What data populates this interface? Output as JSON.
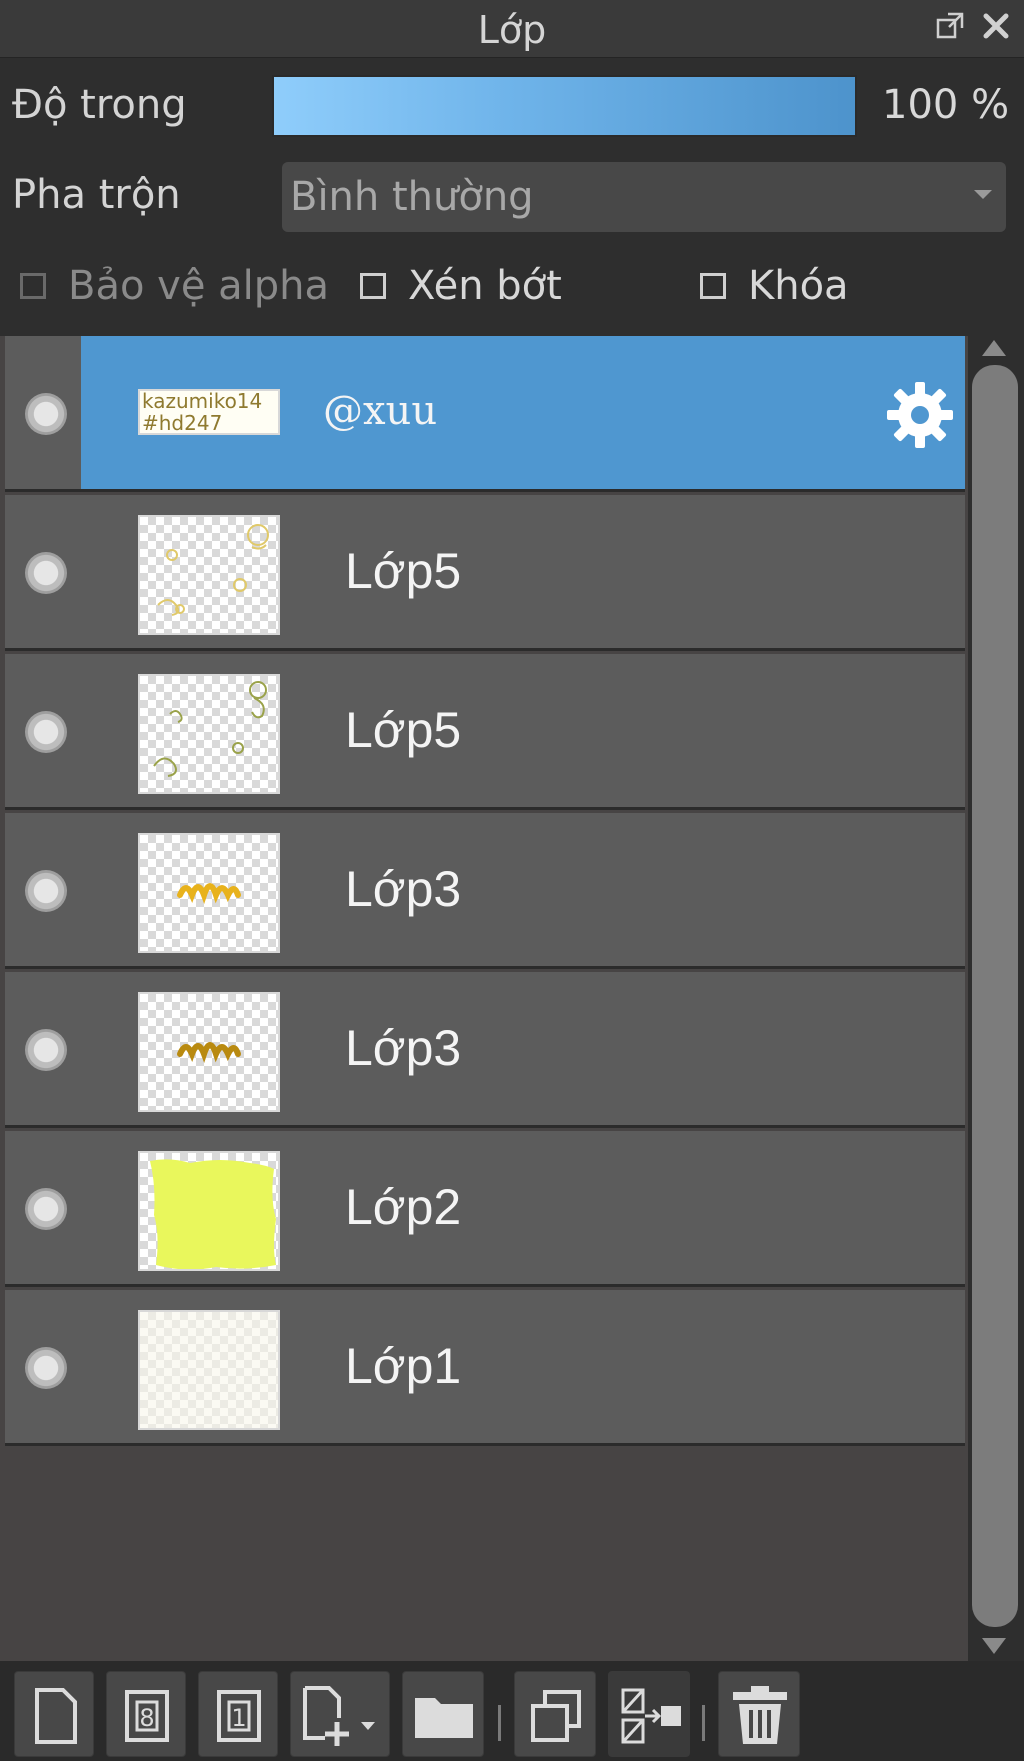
{
  "panel": {
    "title": "Lớp"
  },
  "opacity": {
    "label": "Độ trong",
    "value": "100 %",
    "level": 1.0
  },
  "blend": {
    "label": "Pha trộn",
    "value": "Bình thường"
  },
  "checks": {
    "alpha": {
      "label": "Bảo vệ alpha",
      "checked": false,
      "enabled": false
    },
    "clip": {
      "label": "Xén bớt",
      "checked": false,
      "enabled": true
    },
    "lock": {
      "label": "Khóa",
      "checked": false,
      "enabled": true
    }
  },
  "layers": [
    {
      "name": "@xuu",
      "type": "text",
      "selected": true,
      "thumb_text": [
        "kazumiko14",
        "#hd247"
      ]
    },
    {
      "name": "Lớp5",
      "selected": false
    },
    {
      "name": "Lớp5",
      "selected": false
    },
    {
      "name": "Lớp3",
      "selected": false
    },
    {
      "name": "Lớp3",
      "selected": false
    },
    {
      "name": "Lớp2",
      "selected": false
    },
    {
      "name": "Lớp1",
      "selected": false
    }
  ],
  "toolbar": {
    "items": [
      "new-layer-icon",
      "new-8bit-layer-icon",
      "new-1bit-layer-icon",
      "add-layer-menu-icon",
      "new-folder-icon",
      "duplicate-layer-icon",
      "merge-layer-icon",
      "delete-layer-icon"
    ],
    "new_8bit_badge": "8",
    "new_1bit_badge": "1"
  },
  "colors": {
    "selected_row": "#4f97d0",
    "row": "#5c5c5c",
    "opacity_bar": "#6fb4ea",
    "lasso_yellow": "#e9f75c"
  }
}
